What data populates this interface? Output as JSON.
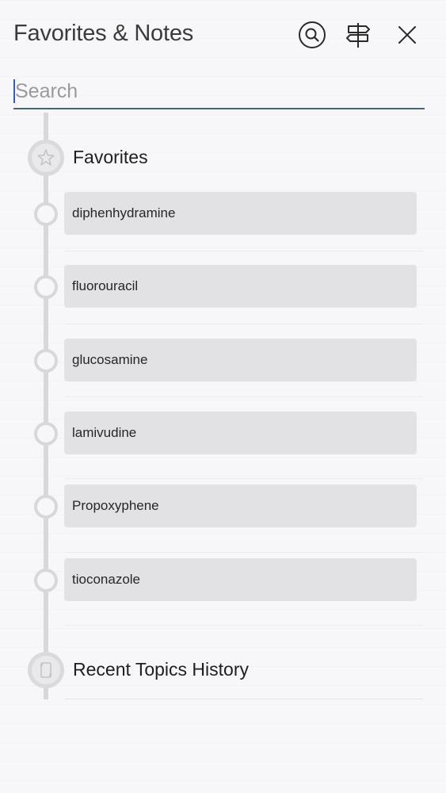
{
  "header": {
    "title": "Favorites & Notes",
    "search_icon": "search-icon",
    "signpost_icon": "signpost-icon",
    "close_icon": "close-icon"
  },
  "search": {
    "placeholder": "Search",
    "value": ""
  },
  "favorites": {
    "label": "Favorites",
    "icon": "star-icon",
    "items": [
      {
        "label": "diphenhydramine"
      },
      {
        "label": "fluorouracil"
      },
      {
        "label": "glucosamine"
      },
      {
        "label": "lamivudine"
      },
      {
        "label": "Propoxyphene"
      },
      {
        "label": "tioconazole"
      }
    ]
  },
  "recent": {
    "label": "Recent Topics History",
    "icon": "history-icon"
  },
  "colors": {
    "accent": "#2f5bd6",
    "underline": "#4b6670",
    "item_bg": "#e2e2e4",
    "timeline": "#d8d8da"
  }
}
